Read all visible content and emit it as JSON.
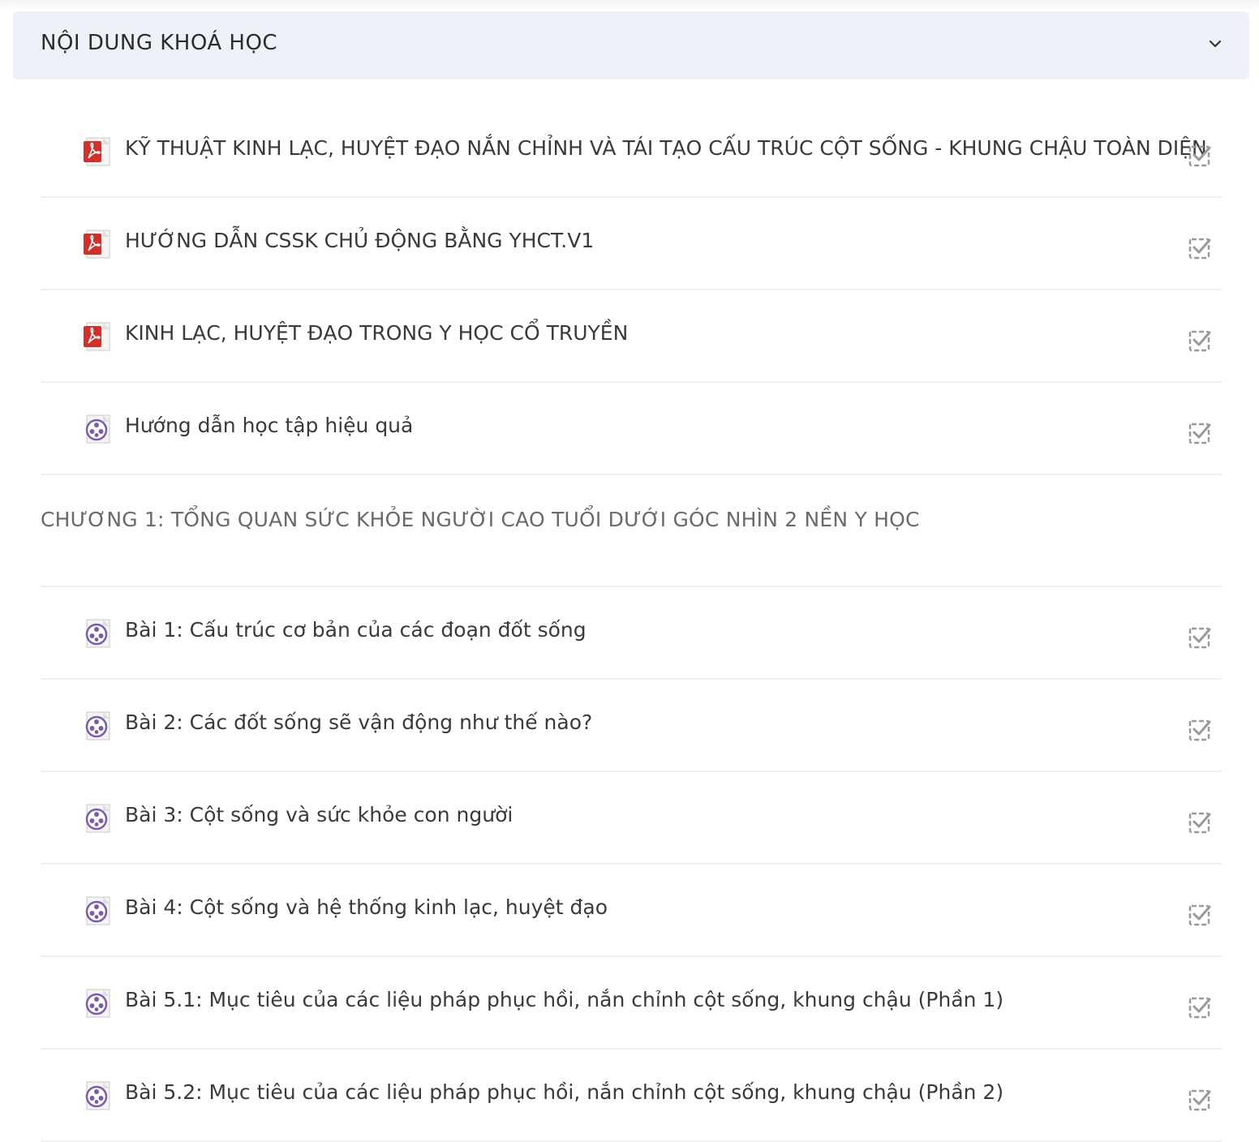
{
  "header": {
    "title": "NỘI DUNG KHOÁ HỌC",
    "toggle_icon": "chevron-down-icon"
  },
  "intro_items": [
    {
      "type": "pdf",
      "title": "KỸ THUẬT KINH LẠC, HUYỆT ĐẠO NẮN CHỈNH VÀ TÁI TẠO CẤU TRÚC CỘT SỐNG - KHUNG CHẬU TOÀN DIỆN",
      "completed": true
    },
    {
      "type": "pdf",
      "title": "HƯỚNG DẪN CSSK CHỦ ĐỘNG BẰNG YHCT.V1",
      "completed": true
    },
    {
      "type": "pdf",
      "title": "KINH LẠC, HUYỆT ĐẠO TRONG Y HỌC CỔ TRUYỀN",
      "completed": true
    },
    {
      "type": "video",
      "title": "Hướng dẫn học tập hiệu quả",
      "completed": true
    }
  ],
  "chapter": {
    "title": "CHƯƠNG 1: TỔNG QUAN SỨC KHỎE NGƯỜI CAO TUỔI DƯỚI GÓC NHÌN 2 NỀN Y HỌC"
  },
  "chapter_items": [
    {
      "type": "video",
      "title": "Bài 1: Cấu trúc cơ bản của các đoạn đốt sống",
      "completed": true
    },
    {
      "type": "video",
      "title": "Bài 2: Các đốt sống sẽ vận động như thế nào?",
      "completed": true
    },
    {
      "type": "video",
      "title": "Bài 3: Cột sống và sức khỏe con người",
      "completed": true
    },
    {
      "type": "video",
      "title": "Bài 4: Cột sống và hệ thống kinh lạc, huyệt đạo",
      "completed": true
    },
    {
      "type": "video",
      "title": "Bài 5.1: Mục tiêu của các liệu pháp phục hồi, nắn chỉnh cột sống, khung chậu (Phần 1)",
      "completed": true
    },
    {
      "type": "video",
      "title": "Bài 5.2: Mục tiêu của các liệu pháp phục hồi, nắn chỉnh cột sống, khung chậu (Phần 2)",
      "completed": true
    }
  ],
  "colors": {
    "header_bg": "#eef1f7",
    "pdf_red": "#d3302a",
    "video_purple": "#7a5bb0",
    "check_gray": "#9a9a9a"
  }
}
